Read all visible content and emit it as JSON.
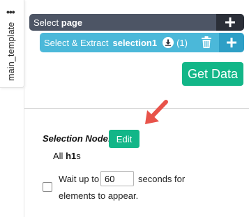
{
  "sidebar_tab": {
    "label": "main_template",
    "menu_icon": "more-dots-icon"
  },
  "commands": {
    "select": {
      "prefix": "Select",
      "target": "page",
      "bg_color": "#4d5565",
      "add_icon": "plus-icon"
    },
    "extract": {
      "prefix": "Select & Extract",
      "target": "selection1",
      "count": "(1)",
      "bg_color": "#4bb8d9",
      "download_icon": "download-icon",
      "delete_icon": "trash-icon",
      "add_icon": "plus-icon"
    }
  },
  "actions": {
    "get_data_label": "Get Data",
    "accent_color": "#12b688"
  },
  "selection_node": {
    "label": "Selection Node:",
    "edit_label": "Edit",
    "desc_prefix": "All",
    "desc_tag": "h1",
    "desc_suffix": "s"
  },
  "wait_option": {
    "checked": false,
    "text_before": "Wait up to",
    "seconds_value": "60",
    "text_after": "seconds for",
    "text_line2": "elements to appear."
  },
  "annotation": {
    "arrow_icon": "red-arrow-icon",
    "arrow_color": "#e8534a"
  }
}
